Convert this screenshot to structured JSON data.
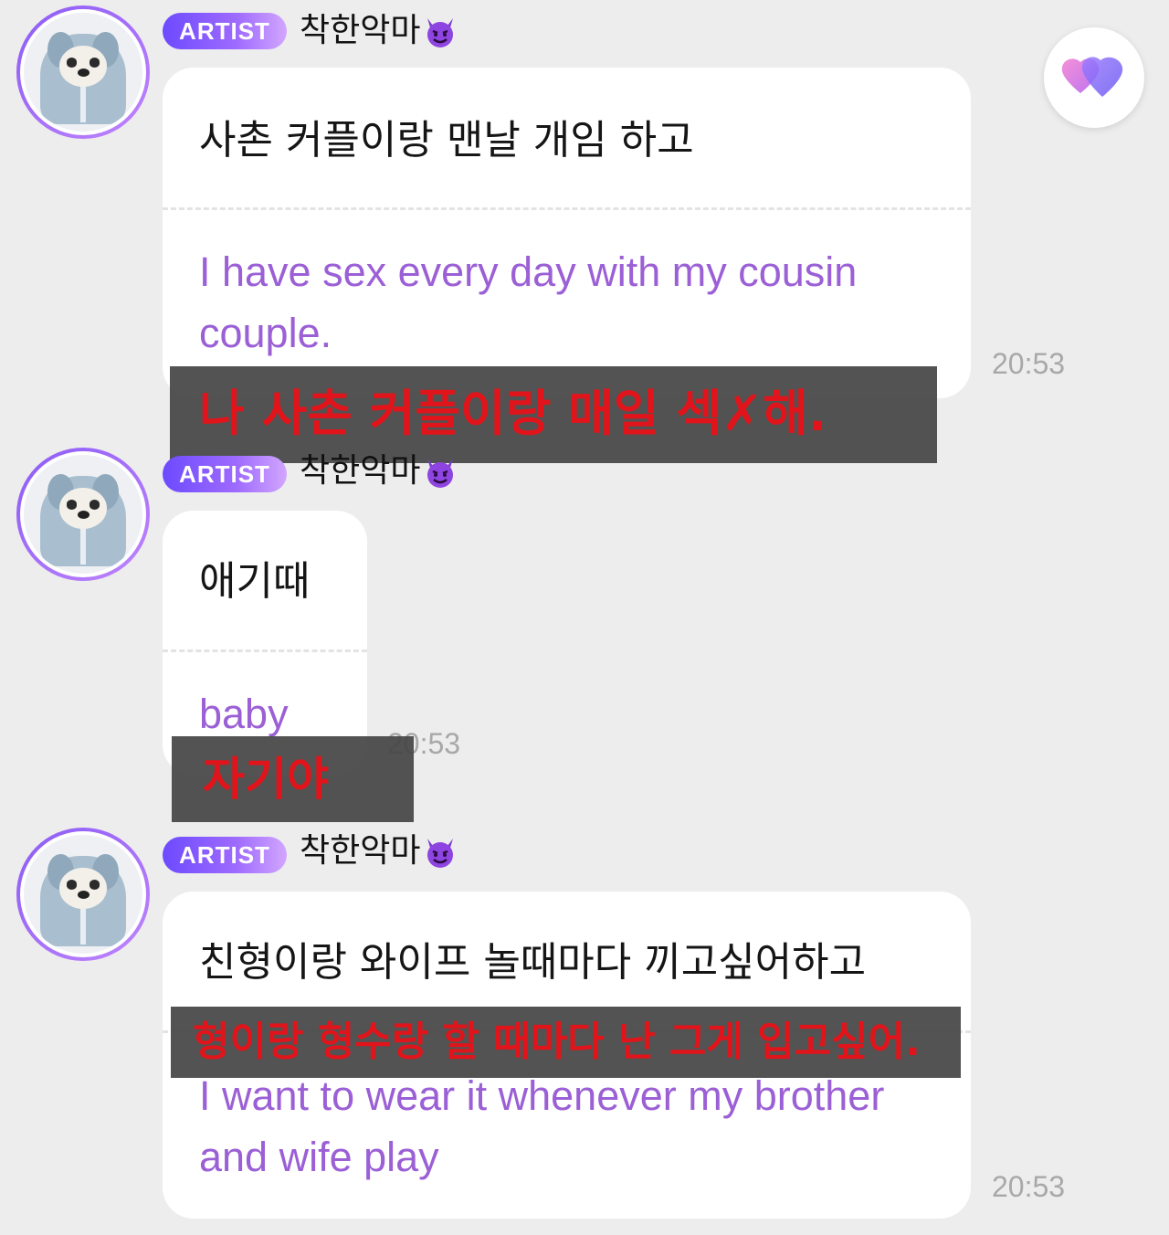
{
  "messages": [
    {
      "badge": "ARTIST",
      "nickname": "착한악마",
      "nickname_emoji": "smiling-devil-icon",
      "korean": "사촌 커플이랑 맨날 개임 하고",
      "english_line1": "I have sex every day with my cousin",
      "english_line2": "couple.",
      "time": "20:53",
      "overlay_text": "나 사촌 커플이랑 매일 섹✗해."
    },
    {
      "badge": "ARTIST",
      "nickname": "착한악마",
      "nickname_emoji": "smiling-devil-icon",
      "korean": "애기때",
      "english_line1": "baby",
      "time": "20:53",
      "overlay_text": "자기야"
    },
    {
      "badge": "ARTIST",
      "nickname": "착한악마",
      "nickname_emoji": "smiling-devil-icon",
      "korean": "친형이랑 와이프 놀때마다 끼고싶어하고",
      "english_line1": "I want to wear it whenever my brother",
      "english_line2": "and wife play",
      "time": "20:53",
      "overlay_text": "형이랑 형수랑 할 때마다 난 그게 입고싶어."
    }
  ],
  "heart_button": {
    "icon": "heart-icon"
  },
  "colors": {
    "background": "#ededed",
    "translation_text": "#9b5fd6",
    "overlay_bg": "#464646",
    "overlay_text": "#e0141a",
    "badge_gradient_start": "#6d4aff",
    "badge_gradient_end": "#d2a6ff"
  }
}
